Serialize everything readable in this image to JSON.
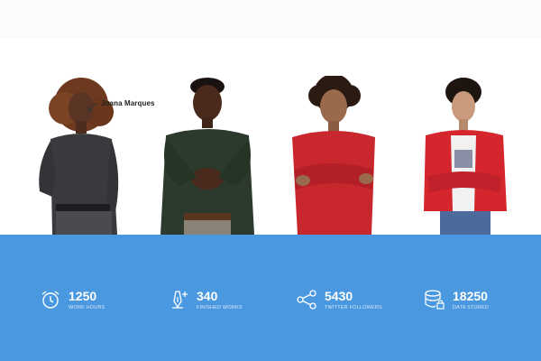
{
  "team": {
    "highlighted_member": {
      "name": "Joana Marques"
    },
    "members": [
      {
        "role": "person-1",
        "shirt": "#3a3a3e"
      },
      {
        "role": "person-2",
        "shirt": "#2b3a2c"
      },
      {
        "role": "person-3",
        "shirt": "#c8272d"
      },
      {
        "role": "person-4",
        "shirt": "#d4262c"
      }
    ]
  },
  "stats": [
    {
      "icon": "alarm-clock-icon",
      "value": "1250",
      "label": "WORK HOURS"
    },
    {
      "icon": "pen-plus-icon",
      "value": "340",
      "label": "FINISHED WORKS"
    },
    {
      "icon": "share-icon",
      "value": "5430",
      "label": "TWITTER FOLLOWERS"
    },
    {
      "icon": "database-lock-icon",
      "value": "18250",
      "label": "DATA STORED"
    }
  ],
  "colors": {
    "band": "#4a98df",
    "text_light": "#ffffff"
  }
}
